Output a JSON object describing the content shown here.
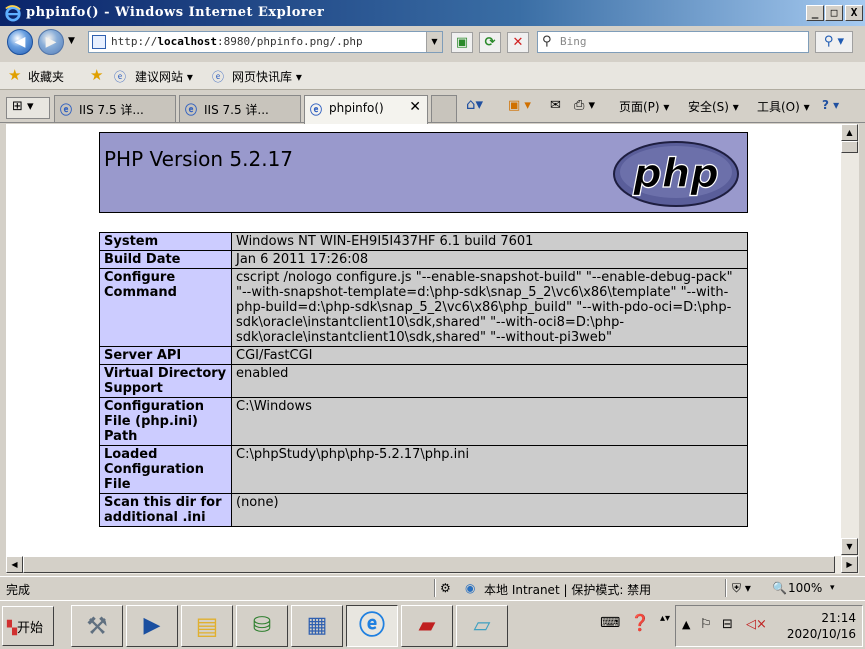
{
  "window": {
    "title": "phpinfo() - Windows Internet Explorer",
    "min_label": "_",
    "max_label": "□",
    "close_label": "X"
  },
  "address": {
    "url_prefix": "http://",
    "url_host": "localhost",
    "url_rest": ":8980/phpinfo.png/.php",
    "search_placeholder": "Bing"
  },
  "favorites": {
    "label": "收藏夹",
    "items": [
      "建议网站 ▾",
      "网页快讯库 ▾"
    ]
  },
  "tabs": [
    {
      "label": "IIS 7.5 详..."
    },
    {
      "label": "IIS 7.5 详..."
    },
    {
      "label": "phpinfo()"
    }
  ],
  "commands": {
    "page": "页面(P) ▾",
    "safety": "安全(S) ▾",
    "tools": "工具(O) ▾",
    "help": "? ▾"
  },
  "php": {
    "version": "PHP Version 5.2.17",
    "logo_text": "php",
    "rows": [
      {
        "key": "System",
        "value": "Windows NT WIN-EH9I5I437HF 6.1 build 7601"
      },
      {
        "key": "Build Date",
        "value": "Jan 6 2011 17:26:08"
      },
      {
        "key": "Configure Command",
        "value": "cscript /nologo configure.js \"--enable-snapshot-build\" \"--enable-debug-pack\" \"--with-snapshot-template=d:\\php-sdk\\snap_5_2\\vc6\\x86\\template\" \"--with-php-build=d:\\php-sdk\\snap_5_2\\vc6\\x86\\php_build\" \"--with-pdo-oci=D:\\php-sdk\\oracle\\instantclient10\\sdk,shared\" \"--with-oci8=D:\\php-sdk\\oracle\\instantclient10\\sdk,shared\" \"--without-pi3web\""
      },
      {
        "key": "Server API",
        "value": "CGI/FastCGI"
      },
      {
        "key": "Virtual Directory Support",
        "value": "enabled"
      },
      {
        "key": "Configuration File (php.ini) Path",
        "value": "C:\\Windows"
      },
      {
        "key": "Loaded Configuration File",
        "value": "C:\\phpStudy\\php\\php-5.2.17\\php.ini"
      },
      {
        "key": "Scan this dir for additional .ini",
        "value": "(none)"
      }
    ]
  },
  "status": {
    "text": "完成",
    "zone": "本地 Intranet | 保护模式: 禁用",
    "zoom": "100%"
  },
  "taskbar": {
    "start_label": "开始",
    "time": "21:14",
    "date": "2020/10/16"
  },
  "colors": {
    "php_header": "#9999cc",
    "php_key": "#ccccff",
    "php_value": "#cccccc"
  }
}
